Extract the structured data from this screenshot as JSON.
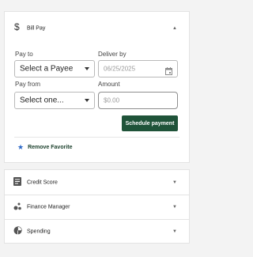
{
  "bill_pay": {
    "title": "Bill Pay",
    "icon": "dollar-icon",
    "pay_to": {
      "label": "Pay to",
      "value": "Select a Payee"
    },
    "deliver_by": {
      "label": "Deliver by",
      "value": "06/25/2025",
      "icon": "calendar-icon"
    },
    "pay_from": {
      "label": "Pay from",
      "value": "Select one..."
    },
    "amount": {
      "label": "Amount",
      "placeholder": "$0.00"
    },
    "schedule_button": "Schedule payment",
    "remove_favorite": "Remove Favorite"
  },
  "sections": [
    {
      "label": "Credit Score",
      "icon": "document-icon"
    },
    {
      "label": "Finance Manager",
      "icon": "dots-icon"
    },
    {
      "label": "Spending",
      "icon": "pie-chart-icon"
    }
  ],
  "colors": {
    "primary_button": "#1f5339",
    "star": "#2b67c6",
    "background": "#f3f3f3"
  }
}
